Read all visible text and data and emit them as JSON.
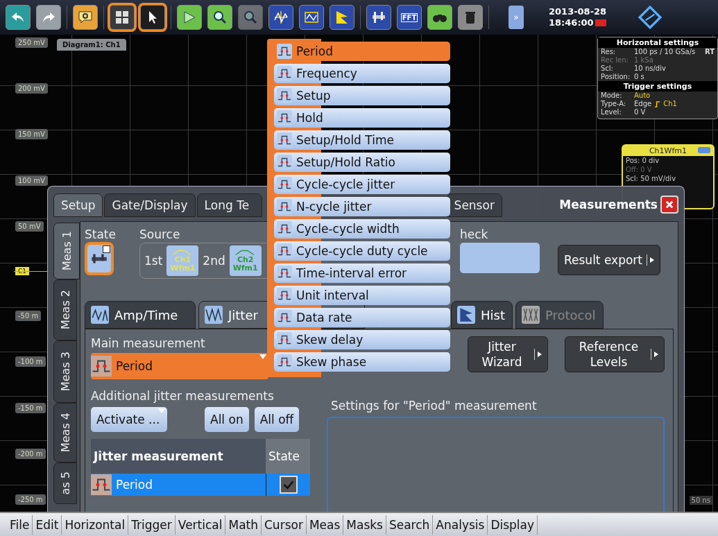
{
  "toolbar": {
    "buttons": [
      {
        "kind": "undo",
        "selected": false,
        "disabled": false
      },
      {
        "kind": "redo",
        "selected": false,
        "disabled": false
      },
      {
        "kind": "help",
        "selected": false,
        "disabled": false
      },
      {
        "kind": "layout",
        "selected": true,
        "disabled": false
      },
      {
        "kind": "pointer",
        "selected": true,
        "disabled": false
      },
      {
        "kind": "marker",
        "selected": false,
        "disabled": false
      },
      {
        "kind": "zoom",
        "selected": false,
        "disabled": false
      },
      {
        "kind": "zoom-multi",
        "selected": false,
        "disabled": true
      },
      {
        "kind": "grid",
        "selected": false,
        "disabled": false
      },
      {
        "kind": "mask",
        "selected": false,
        "disabled": false
      },
      {
        "kind": "hist",
        "selected": false,
        "disabled": false
      },
      {
        "kind": "caliper",
        "selected": false,
        "disabled": false
      },
      {
        "kind": "fft",
        "label": "FFT",
        "selected": false,
        "disabled": false
      },
      {
        "kind": "binoculars",
        "selected": false,
        "disabled": false
      },
      {
        "kind": "bin",
        "selected": false,
        "disabled": false
      }
    ],
    "expand": "»",
    "date": "2013-08-28",
    "time": "18:46:00"
  },
  "diagram": {
    "tab": "Diagram1: Ch1",
    "y_labels": [
      "250 mV",
      "200 mV",
      "150 mV",
      "100 mV",
      "50 mV",
      "-50 m",
      "-100 m",
      "-150 m",
      "-200 m",
      "-250 m"
    ],
    "channel_marker": "C1",
    "time_label": "50 ns"
  },
  "horizontal_settings": {
    "title": "Horizontal settings",
    "mode_badge": "RT",
    "rows": [
      {
        "label": "Res:",
        "value": "100 ps / 10 GSa/s",
        "disabled": false
      },
      {
        "label": "Rec len:",
        "value": "1 kSa",
        "disabled": true
      },
      {
        "label": "Scl:",
        "value": "10 ns/div",
        "disabled": false
      },
      {
        "label": "Position:",
        "value": "0 s",
        "disabled": false
      }
    ]
  },
  "trigger_settings": {
    "title": "Trigger settings",
    "rows": [
      {
        "label": "Mode:",
        "value": "Auto",
        "highlight": true
      },
      {
        "label": "Type-A:",
        "value": "Edge",
        "source": "Ch1",
        "highlight": false
      },
      {
        "label": "Level:",
        "value": "0 V",
        "highlight": false
      }
    ]
  },
  "channel_box": {
    "title": "Ch1Wfm1",
    "lines": [
      {
        "text": "Pos: 0 div",
        "dim": false
      },
      {
        "text": "Off: 0 V",
        "dim": true
      },
      {
        "text": "Scl: 50 mV/div",
        "dim": false
      }
    ]
  },
  "dialog": {
    "title": "Measurements",
    "tabs": [
      {
        "label": "Setup",
        "selected": true
      },
      {
        "label": "Gate/Display",
        "selected": false
      },
      {
        "label": "Long Te",
        "selected": false
      },
      {
        "label": "Sensor",
        "selected": false
      }
    ],
    "meas_tabs": [
      {
        "label": "Meas 1",
        "selected": true
      },
      {
        "label": "Meas 2",
        "selected": false
      },
      {
        "label": "Meas 3",
        "selected": false
      },
      {
        "label": "Meas 4",
        "selected": false
      },
      {
        "label": "as 5",
        "selected": false
      }
    ],
    "state_label": "State",
    "state_checked": true,
    "source_label": "Source",
    "sources": [
      {
        "label": "1st",
        "channel": "Ch1",
        "waveform": "Wfm1",
        "color": "#e6e34a"
      },
      {
        "label": "2nd",
        "channel": "Ch2",
        "waveform": "Wfm1",
        "color": "#2a9a3a"
      }
    ],
    "limit_label": "heck",
    "result_export": "Result export",
    "sub_tabs": [
      {
        "label": "Amp/Time",
        "kind": "amp",
        "selected": false,
        "disabled": false
      },
      {
        "label": "Jitter",
        "kind": "jitter",
        "selected": true,
        "disabled": false
      },
      {
        "label": "Hist",
        "kind": "hist",
        "selected": false,
        "disabled": false
      },
      {
        "label": "Protocol",
        "kind": "protocol",
        "selected": false,
        "disabled": true
      }
    ],
    "main_label": "Main measurement",
    "main_value": "Period",
    "additional_label": "Additional jitter measurements",
    "activate": "Activate ...",
    "all_on": "All on",
    "all_off": "All off",
    "table": {
      "columns": [
        "Jitter measurement",
        "State"
      ],
      "rows": [
        {
          "name": "Period",
          "selected": true,
          "checked": true
        }
      ]
    },
    "jitter_wizard": "Jitter Wizard",
    "reference_levels": "Reference Levels",
    "settings_label": "Settings for \"Period\" measurement"
  },
  "measurement_menu": [
    {
      "label": "Period",
      "selected": true
    },
    {
      "label": "Frequency",
      "selected": false
    },
    {
      "label": "Setup",
      "selected": false
    },
    {
      "label": "Hold",
      "selected": false
    },
    {
      "label": "Setup/Hold Time",
      "selected": false
    },
    {
      "label": "Setup/Hold Ratio",
      "selected": false
    },
    {
      "label": "Cycle-cycle jitter",
      "selected": false
    },
    {
      "label": "N-cycle jitter",
      "selected": false
    },
    {
      "label": "Cycle-cycle width",
      "selected": false
    },
    {
      "label": "Cycle-cycle duty cycle",
      "selected": false
    },
    {
      "label": "Time-interval error",
      "selected": false
    },
    {
      "label": "Unit interval",
      "selected": false
    },
    {
      "label": "Data rate",
      "selected": false
    },
    {
      "label": "Skew delay",
      "selected": false
    },
    {
      "label": "Skew phase",
      "selected": false
    }
  ],
  "menu_bar": [
    "File",
    "Edit",
    "Horizontal",
    "Trigger",
    "Vertical",
    "Math",
    "Cursor",
    "Meas",
    "Masks",
    "Search",
    "Analysis",
    "Display"
  ]
}
